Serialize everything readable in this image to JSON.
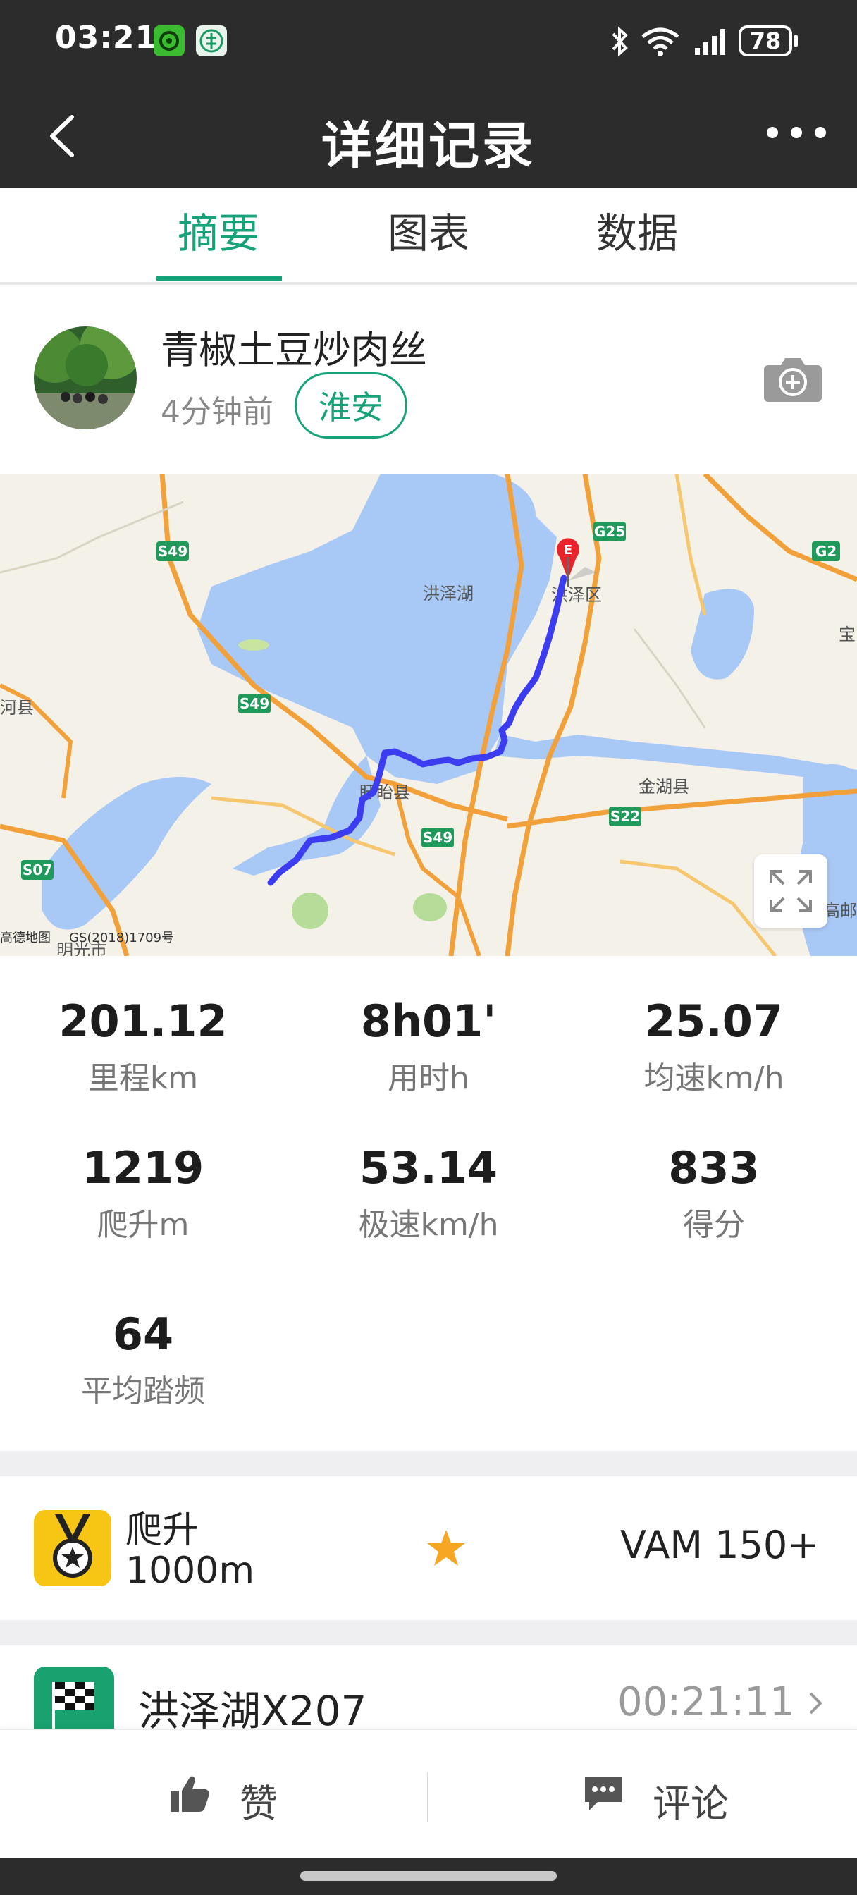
{
  "status_bar": {
    "time": "03:21",
    "battery": "78",
    "icons": [
      "app-green-icon",
      "app-bank-icon",
      "bluetooth-icon",
      "wifi-icon",
      "signal-icon",
      "battery-icon"
    ]
  },
  "header": {
    "title": "详细记录",
    "back_icon": "back-arrow-icon",
    "more_icon": "more-dots-icon"
  },
  "tabs": [
    {
      "label": "摘要",
      "active": true
    },
    {
      "label": "图表",
      "active": false
    },
    {
      "label": "数据",
      "active": false
    }
  ],
  "profile": {
    "name": "青椒土豆炒肉丝",
    "time_ago": "4分钟前",
    "city": "淮安",
    "camera_icon": "camera-add-icon"
  },
  "map": {
    "labels": {
      "lake": "洪泽湖",
      "district": "洪泽区",
      "county1": "盱眙县",
      "county2": "金湖县",
      "left_county": "河县",
      "right_county": "宝",
      "right_bottom": "高邮",
      "copyright": "GS(2018)1709号",
      "provider": "高德地图",
      "bottom_left": "明光市"
    },
    "road_labels": [
      "S49",
      "S49",
      "S49",
      "G25",
      "G2",
      "S22",
      "S07"
    ],
    "end_marker": "E",
    "route_color": "#3c3cf0",
    "expand_icon": "expand-icon"
  },
  "stats": [
    {
      "value": "201.12",
      "label": "里程km"
    },
    {
      "value": "8h01'",
      "label": "用时h"
    },
    {
      "value": "25.07",
      "label": "均速km/h"
    },
    {
      "value": "1219",
      "label": "爬升m"
    },
    {
      "value": "53.14",
      "label": "极速km/h"
    },
    {
      "value": "833",
      "label": "得分"
    },
    {
      "value": "64",
      "label": "平均踏频"
    }
  ],
  "achievement": {
    "title": "爬升",
    "subtitle": "1000m",
    "vam": "VAM 150+",
    "icon": "medal-icon",
    "star_icon": "star-icon"
  },
  "segment": {
    "name": "洪泽湖X207",
    "time": "00:21:11",
    "icon": "checkered-flag-icon"
  },
  "actions": {
    "like_label": "赞",
    "comment_label": "评论"
  },
  "colors": {
    "accent": "#17a37a",
    "header_bg": "#2c2c2d",
    "medal_bg": "#f7c615",
    "segment_bg": "#19a26f"
  }
}
